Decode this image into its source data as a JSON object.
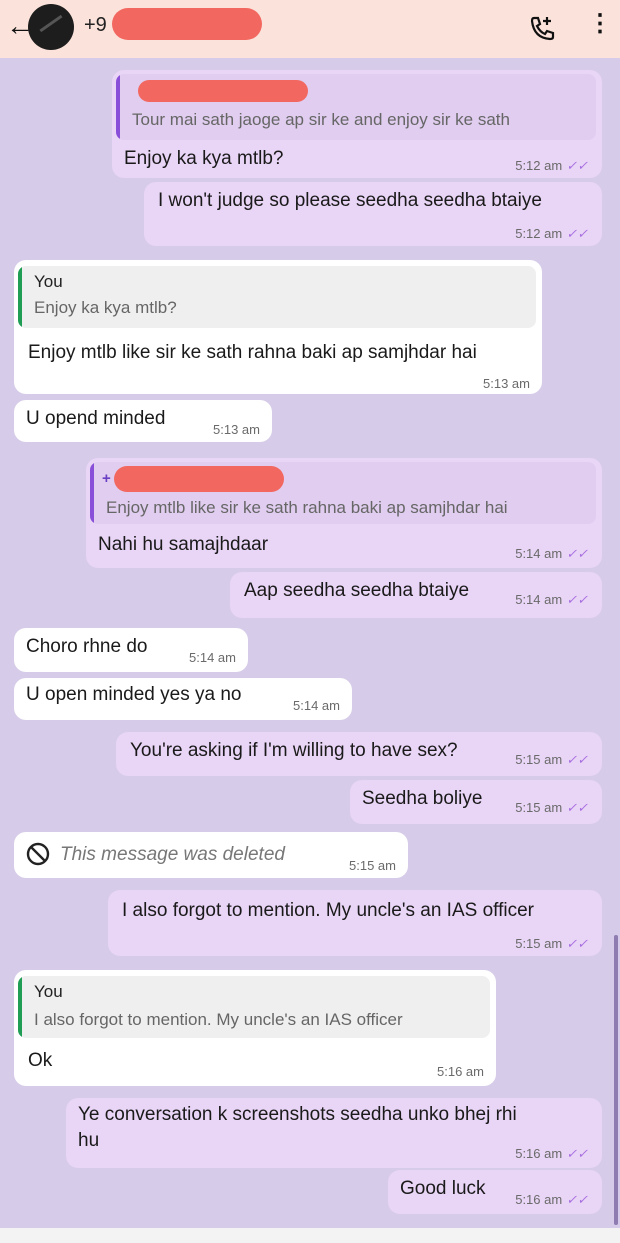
{
  "header": {
    "back_icon": "back-arrow-icon",
    "contact_number": "+9",
    "add_call_icon": "add-call-icon",
    "menu_icon": "more-vert-icon"
  },
  "colors": {
    "header_bg": "#fbe3db",
    "chat_bg": "#d6cbe9",
    "sent_bubble": "#e9d5f6",
    "received_bubble": "#ffffff",
    "read_ticks": "#a86fe0",
    "redaction": "#f26860"
  },
  "messages": [
    {
      "dir": "sent",
      "quote": {
        "author": "",
        "text": "Tour mai sath jaoge ap sir ke and enjoy sir ke sath"
      },
      "text": "Enjoy ka kya mtlb?",
      "time": "5:12 am",
      "ticks": "✓✓"
    },
    {
      "dir": "sent",
      "text": "I won't judge so please seedha seedha btaiye",
      "time": "5:12 am",
      "ticks": "✓✓"
    },
    {
      "dir": "received",
      "quote": {
        "author": "You",
        "text": "Enjoy ka kya mtlb?"
      },
      "text": "Enjoy mtlb like sir ke sath rahna baki ap samjhdar hai",
      "time": "5:13 am"
    },
    {
      "dir": "received",
      "text": "U opend minded",
      "time": "5:13 am"
    },
    {
      "dir": "sent",
      "quote": {
        "author": "+",
        "text": "Enjoy mtlb like sir ke sath rahna baki ap samjhdar hai"
      },
      "text": "Nahi hu samajhdaar",
      "time": "5:14 am",
      "ticks": "✓✓"
    },
    {
      "dir": "sent",
      "text": "Aap seedha seedha btaiye",
      "time": "5:14 am",
      "ticks": "✓✓"
    },
    {
      "dir": "received",
      "text": "Choro rhne do",
      "time": "5:14 am"
    },
    {
      "dir": "received",
      "text": "U open minded yes ya no",
      "time": "5:14 am"
    },
    {
      "dir": "sent",
      "text": "You're asking if I'm willing to have sex?",
      "time": "5:15 am",
      "ticks": "✓✓"
    },
    {
      "dir": "sent",
      "text": "Seedha boliye",
      "time": "5:15 am",
      "ticks": "✓✓"
    },
    {
      "dir": "received",
      "deleted": true,
      "text": "This message was deleted",
      "time": "5:15 am"
    },
    {
      "dir": "sent",
      "text": "I also forgot to mention. My uncle's an IAS officer",
      "time": "5:15 am",
      "ticks": "✓✓"
    },
    {
      "dir": "received",
      "quote": {
        "author": "You",
        "text": "I also forgot to mention. My uncle's an IAS officer"
      },
      "text": "Ok",
      "time": "5:16 am"
    },
    {
      "dir": "sent",
      "text": "Ye conversation k screenshots seedha unko bhej rhi",
      "text2": "hu",
      "time": "5:16 am",
      "ticks": "✓✓"
    },
    {
      "dir": "sent",
      "text": "Good luck",
      "time": "5:16 am",
      "ticks": "✓✓"
    }
  ]
}
